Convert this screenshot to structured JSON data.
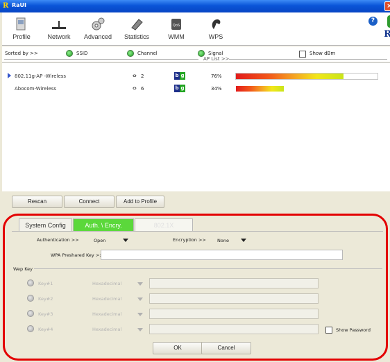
{
  "window": {
    "title": "RaUI",
    "close_glyph": "×"
  },
  "toolbar": {
    "items": [
      {
        "label": "Profile",
        "icon": "profile-icon"
      },
      {
        "label": "Network",
        "icon": "network-icon"
      },
      {
        "label": "Advanced",
        "icon": "advanced-icon"
      },
      {
        "label": "Statistics",
        "icon": "statistics-icon"
      },
      {
        "label": "WMM",
        "icon": "wmm-icon"
      },
      {
        "label": "WPS",
        "icon": "wps-icon"
      }
    ],
    "help_glyph": "?",
    "logo_glyph": "R"
  },
  "sortbar": {
    "sorted_by": "Sorted by >>",
    "ssid": "SSID",
    "channel": "Channel",
    "signal": "Signal",
    "show_dbm": "Show dBm",
    "ap_list": "AP List >>"
  },
  "ap_list": [
    {
      "ssid": "802.11g-AP -Wireless",
      "channel": "2",
      "mode_b": "b",
      "mode_g": "g",
      "signal": "76%",
      "signal_level": 0.76,
      "selected": true
    },
    {
      "ssid": "Abocom-Wireless",
      "channel": "6",
      "mode_b": "b",
      "mode_g": "g",
      "signal": "34%",
      "signal_level": 0.34,
      "selected": false
    }
  ],
  "buttons": {
    "rescan": "Rescan",
    "connect": "Connect",
    "add_to_profile": "Add to Profile",
    "ok": "OK",
    "cancel": "Cancel"
  },
  "tabs": {
    "system_config": "System Config",
    "auth_encry": "Auth. \\ Encry.",
    "dot1x": "802.1X"
  },
  "auth": {
    "authentication_label": "Authentication >>",
    "authentication_value": "Open",
    "encryption_label": "Encryption >>",
    "encryption_value": "None",
    "wpa_psk_label": "WPA Preshared Key >>",
    "wpa_psk_value": ""
  },
  "wep": {
    "title": "Wep Key",
    "keys": [
      {
        "label": "Key#1",
        "format": "Hexadecimal",
        "value": ""
      },
      {
        "label": "Key#2",
        "format": "Hexadecimal",
        "value": ""
      },
      {
        "label": "Key#3",
        "format": "Hexadecimal",
        "value": ""
      },
      {
        "label": "Key#4",
        "format": "Hexadecimal",
        "value": ""
      }
    ],
    "show_password": "Show Password"
  },
  "colors": {
    "accent_green": "#5bd83b",
    "highlight_red": "#e30000",
    "title_blue": "#0a55d8"
  }
}
